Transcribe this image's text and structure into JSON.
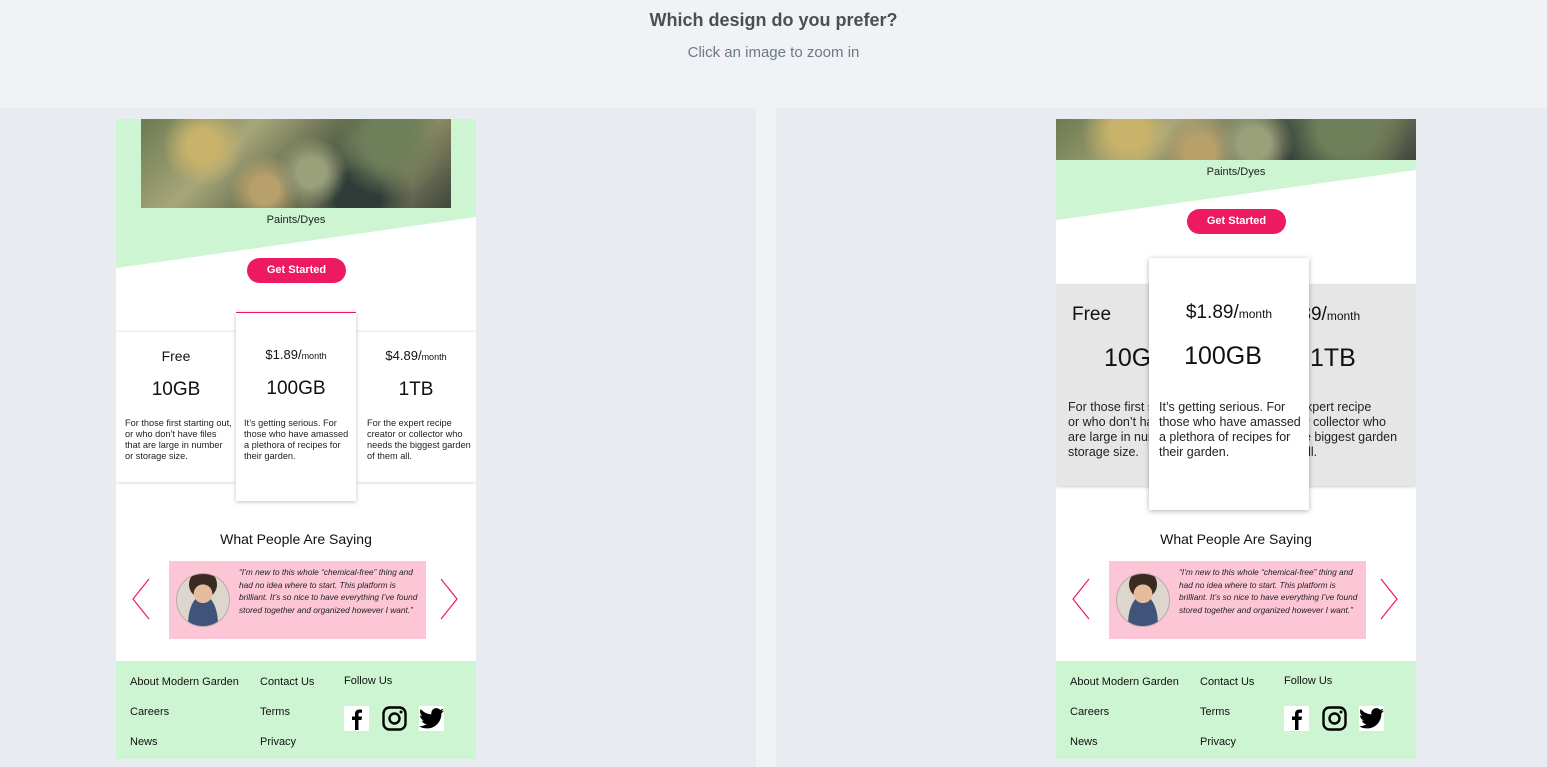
{
  "header": {
    "title": "Which design do you prefer?",
    "subtitle": "Click an image to zoom in"
  },
  "design": {
    "category": "Paints/Dyes",
    "cta_label": "Get Started",
    "plans": [
      {
        "price": "Free",
        "per": "",
        "size": "10GB",
        "desc": "For those first starting out, or who don’t have files that are large in number or storage size."
      },
      {
        "price": "$1.89/",
        "per": "month",
        "size": "100GB",
        "desc": "It’s getting serious. For those who have amassed a plethora of recipes for their garden."
      },
      {
        "price": "$4.89/",
        "per": "month",
        "size": "1TB",
        "desc": "For the expert recipe creator or collector who needs the biggest garden of  them all."
      }
    ],
    "testimonials_title": "What People Are Saying",
    "quote": "“I’m new to this whole “chemical-free” thing and had no idea where to start. This platform is brilliant. It’s so nice to have everything I’ve found stored together and organized however I want.”",
    "footer": {
      "links_col1": [
        "About Modern Garden",
        "Careers",
        "News"
      ],
      "links_col2": [
        "Contact Us",
        "Terms",
        "Privacy"
      ],
      "follow_label": "Follow Us"
    }
  },
  "colors": {
    "accent_pink": "#ee1a5f",
    "mint_green": "#cef5d2",
    "quote_pink": "#fcc6d6"
  },
  "icons": [
    "chevron-left-icon",
    "chevron-right-icon",
    "facebook-icon",
    "instagram-icon",
    "twitter-icon"
  ]
}
